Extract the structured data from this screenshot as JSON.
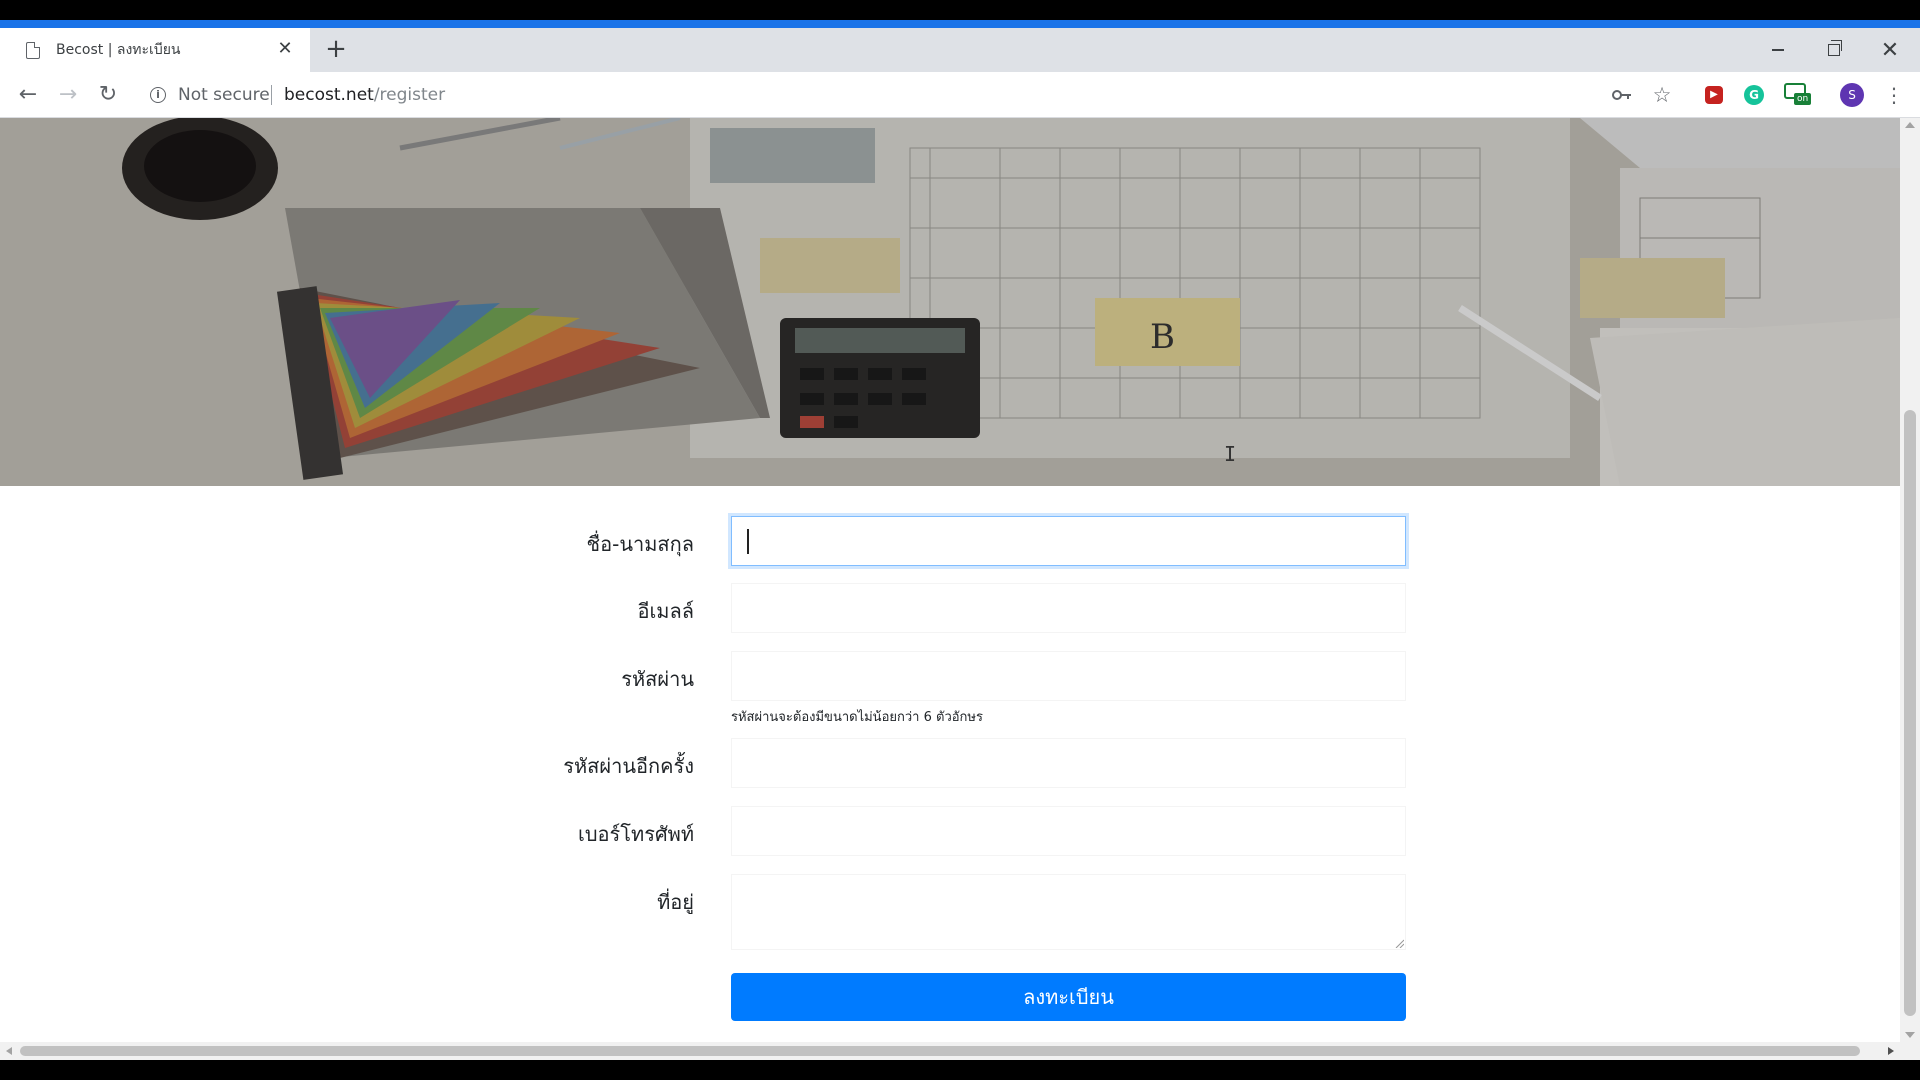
{
  "browser": {
    "tab_title": "Becost | ลงทะเบียน",
    "security_label": "Not secure",
    "url_domain": "becost.net",
    "url_path": "/register",
    "avatar_letter": "S",
    "extension_badge": "on",
    "accent_color": "#1a73e8"
  },
  "form": {
    "fields": [
      {
        "label": "ชื่อ-นามสกุล",
        "value": ""
      },
      {
        "label": "อีเมลล์",
        "value": ""
      },
      {
        "label": "รหัสผ่าน",
        "value": ""
      },
      {
        "label": "รหัสผ่านอีกครั้ง",
        "value": ""
      },
      {
        "label": "เบอร์โทรศัพท์",
        "value": ""
      },
      {
        "label": "ที่อยู่",
        "value": ""
      }
    ],
    "password_help": "รหัสผ่านจะต้องมีขนาดไม่น้อยกว่า 6 ตัวอักษร",
    "submit_label": "ลงทะเบียน",
    "submit_color": "#007bff"
  },
  "hero": {
    "sticky_note_text": "B"
  }
}
